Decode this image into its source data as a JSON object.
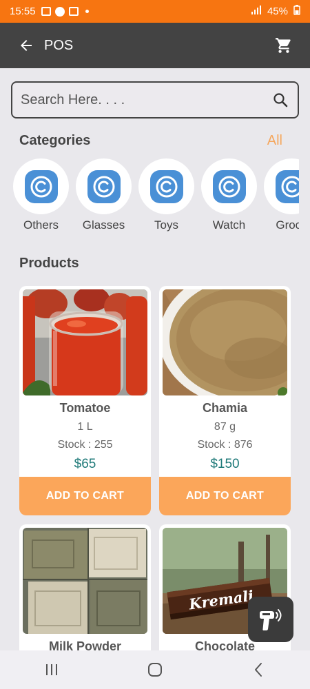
{
  "status_bar": {
    "time": "15:55",
    "battery": "45%"
  },
  "app_bar": {
    "title": "POS",
    "back_icon": "arrow-left-icon",
    "cart_icon": "cart-icon"
  },
  "search": {
    "placeholder": "Search Here. . . ."
  },
  "categories": {
    "title": "Categories",
    "all_label": "All",
    "items": [
      {
        "label": "Others"
      },
      {
        "label": "Glasses"
      },
      {
        "label": "Toys"
      },
      {
        "label": "Watch"
      },
      {
        "label": "Groce"
      }
    ]
  },
  "products": {
    "title": "Products",
    "items": [
      {
        "name": "Tomatoe",
        "unit": "1 L",
        "stock": "Stock : 255",
        "price": "$65",
        "button": "ADD TO CART"
      },
      {
        "name": "Chamia",
        "unit": "87 g",
        "stock": "Stock : 876",
        "price": "$150",
        "button": "ADD TO CART"
      },
      {
        "name": "Milk Powder"
      },
      {
        "name": "Chocolate",
        "brand_text": "Kremali"
      }
    ]
  },
  "colors": {
    "status_bar": "#f77511",
    "app_bar": "#434343",
    "accent": "#fba65a",
    "price": "#1f7a79",
    "category_icon": "#4a90d6"
  }
}
